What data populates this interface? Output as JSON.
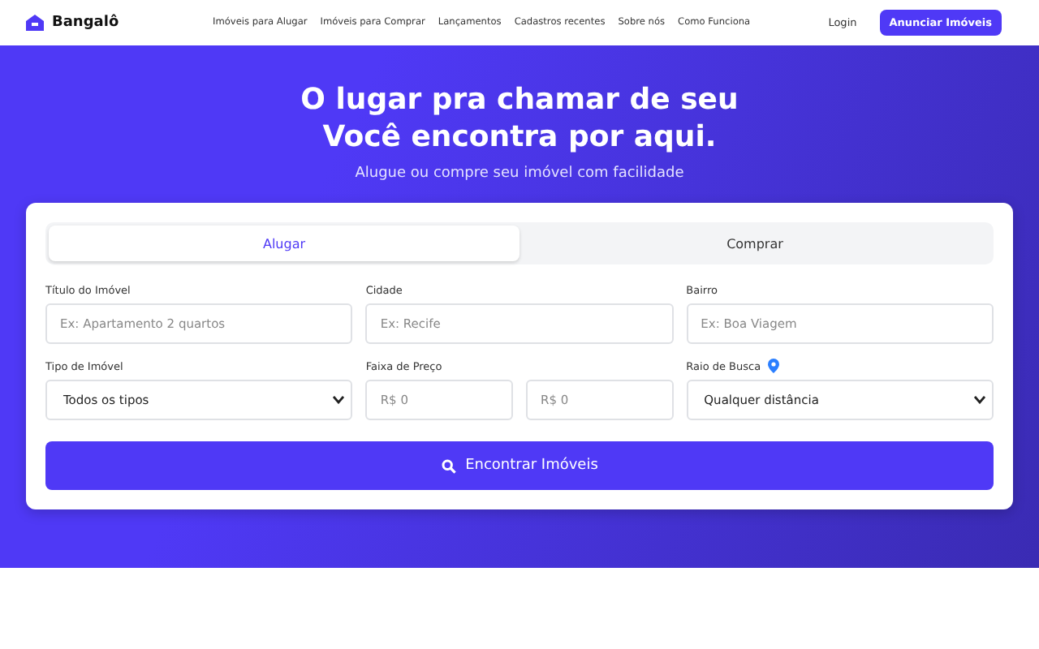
{
  "brand": {
    "name": "Bangalô"
  },
  "nav": {
    "links": [
      "Imóveis para Alugar",
      "Imóveis para Comprar",
      "Lançamentos",
      "Cadastros recentes",
      "Sobre nós",
      "Como Funciona"
    ],
    "login": "Login",
    "cta": "Anunciar Imóveis"
  },
  "hero": {
    "title_line_1": "O lugar pra chamar de seu",
    "title_line_2": "Você encontra por aqui.",
    "subtitle": "Alugue ou compre seu imóvel com facilidade"
  },
  "tabs": [
    {
      "label": "Alugar",
      "selected": true
    },
    {
      "label": "Comprar",
      "selected": false
    }
  ],
  "fields": [
    {
      "kind": "text",
      "label": "Título do Imóvel",
      "placeholder": "Ex: Apartamento 2 quartos"
    },
    {
      "kind": "text",
      "label": "Cidade",
      "placeholder": "Ex: Recife"
    },
    {
      "kind": "text",
      "label": "Bairro",
      "placeholder": "Ex: Boa Viagem"
    },
    {
      "kind": "select",
      "label": "Tipo de Imóvel",
      "value": "Todos os tipos"
    },
    {
      "kind": "range",
      "label": "Faixa de Preço",
      "placeholder_min": "R$ 0",
      "placeholder_max": "R$ 0"
    },
    {
      "kind": "select",
      "label": "Raio de Busca",
      "value": "Qualquer distância",
      "pin": true
    }
  ],
  "search_button": "Encontrar Imóveis"
}
